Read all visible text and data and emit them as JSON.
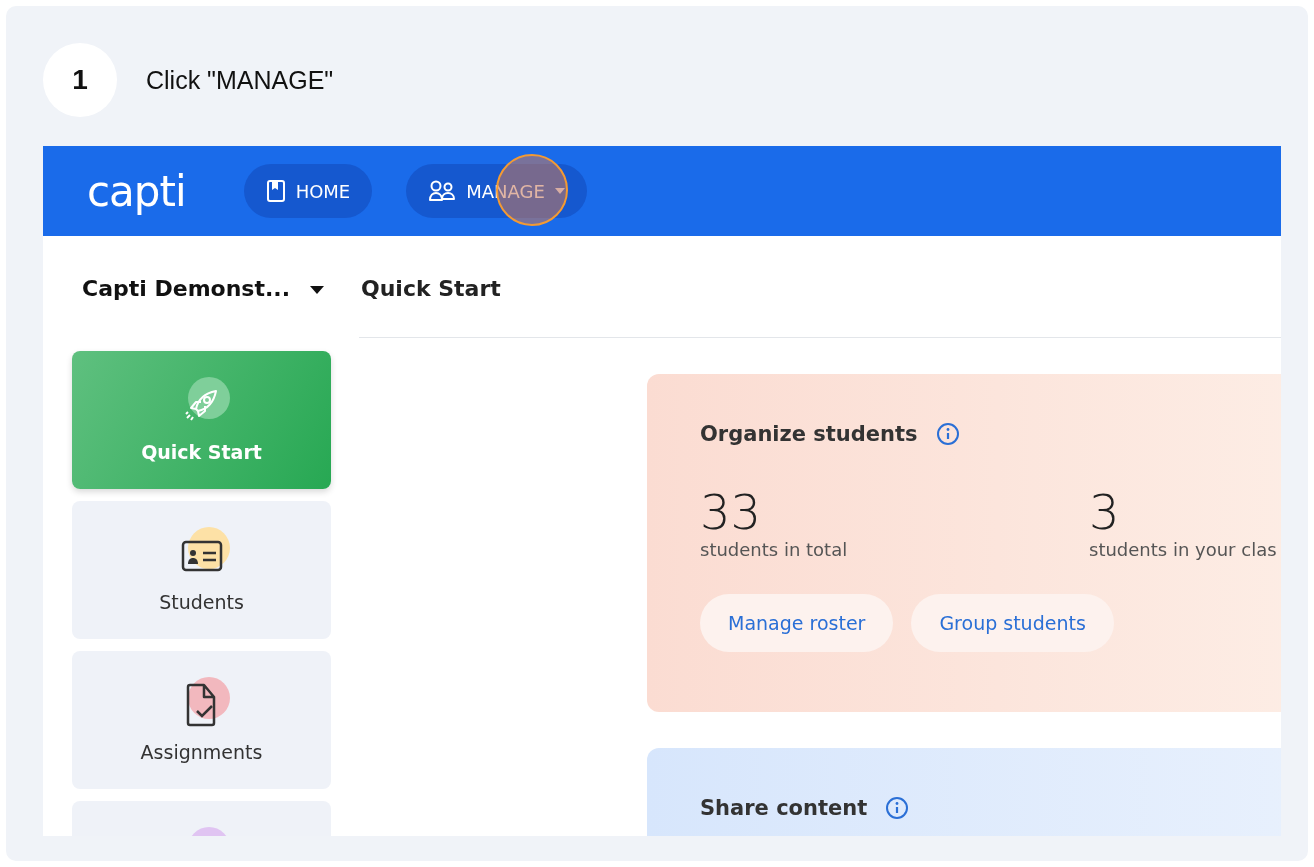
{
  "step": {
    "number": "1",
    "instruction": "Click \"MANAGE\""
  },
  "header": {
    "logo": "capti",
    "nav": [
      {
        "label": "HOME",
        "kind": "book",
        "dropdown": false,
        "highlighted": false
      },
      {
        "label": "MANAGE",
        "kind": "people",
        "dropdown": true,
        "highlighted": true
      }
    ]
  },
  "org_selector": {
    "value": "Capti Demonst..."
  },
  "sidebar": {
    "items": [
      {
        "label": "Quick Start",
        "kind": "rocket",
        "selected": true,
        "color": "#7fcf9a"
      },
      {
        "label": "Students",
        "kind": "card",
        "selected": false,
        "color": "#fde1a6"
      },
      {
        "label": "Assignments",
        "kind": "document",
        "selected": false,
        "color": "#f2b8be"
      },
      {
        "kind": "blank",
        "selected": false,
        "color": "#e0c4f2"
      }
    ]
  },
  "page_title": "Quick Start",
  "cards": [
    {
      "kind": "organize",
      "title": "Organize students",
      "stats": [
        {
          "value": "33",
          "label": "students in total"
        },
        {
          "value": "3",
          "label": "students in your clas"
        }
      ],
      "buttons": [
        "Manage roster",
        "Group students"
      ]
    },
    {
      "kind": "share",
      "title": "Share content"
    }
  ]
}
